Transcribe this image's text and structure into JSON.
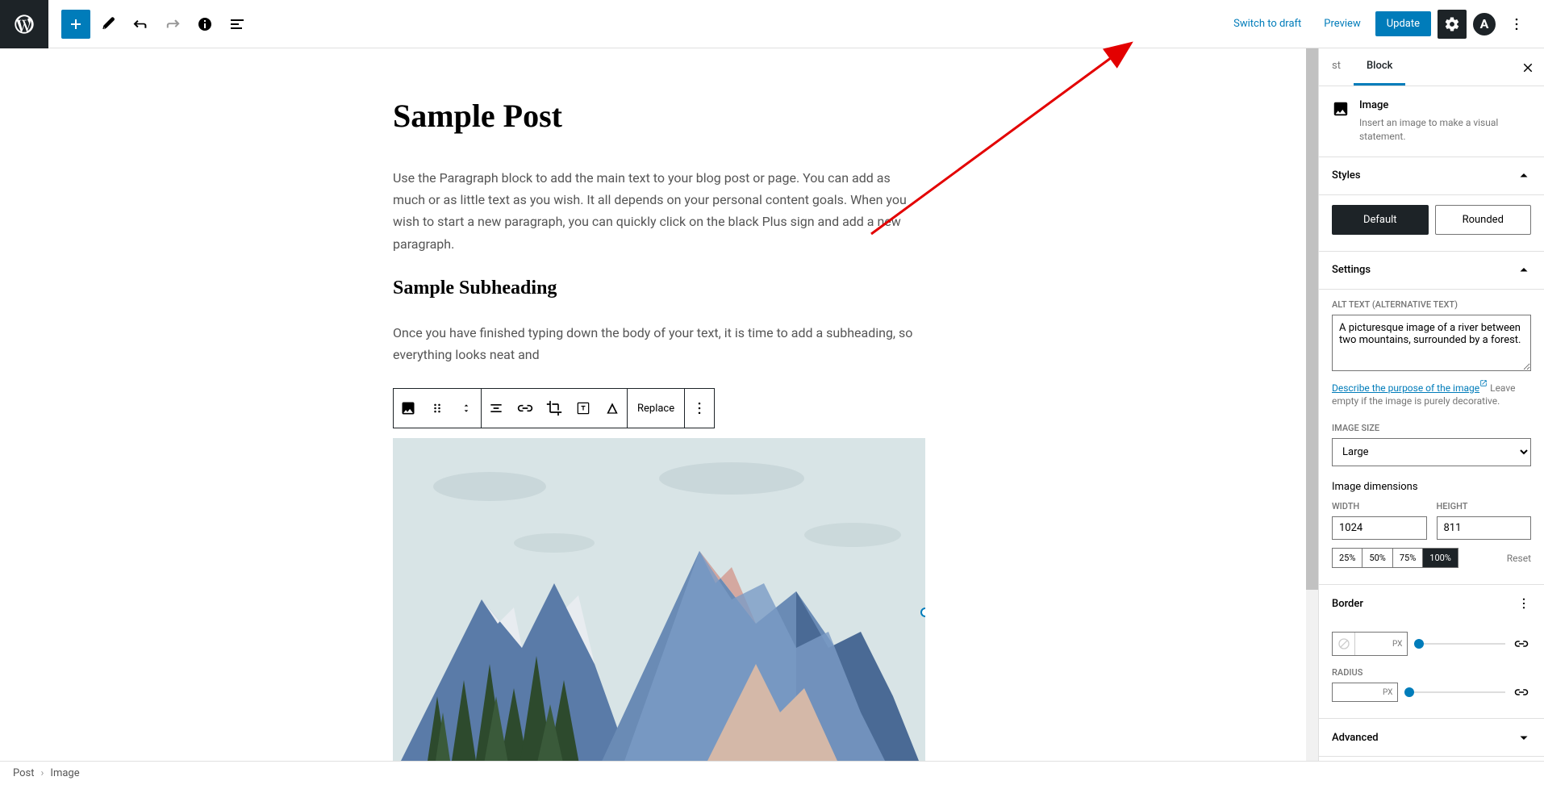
{
  "toolbar": {
    "switch_draft": "Switch to draft",
    "preview": "Preview",
    "update": "Update"
  },
  "editor": {
    "title": "Sample Post",
    "paragraph1": "Use the Paragraph block to add the main text to your blog post or page. You can add as much or as little text as you wish. It all depends on your personal content goals. When you wish to start a new paragraph, you can quickly click on the black Plus sign and add a new paragraph.",
    "subheading": "Sample Subheading",
    "paragraph2": "Once you have finished typing down the body of your text, it is time to add a subheading, so everything looks neat and",
    "replace_btn": "Replace"
  },
  "sidebar": {
    "tab_post": "st",
    "tab_block": "Block",
    "block_name": "Image",
    "block_desc": "Insert an image to make a visual statement.",
    "styles_header": "Styles",
    "style_default": "Default",
    "style_rounded": "Rounded",
    "settings_header": "Settings",
    "alt_label": "ALT TEXT (ALTERNATIVE TEXT)",
    "alt_value": "A picturesque image of a river between two mountains, surrounded by a forest.",
    "alt_help_link": "Describe the purpose of the image",
    "alt_help_text": "Leave empty if the image is purely decorative.",
    "size_label": "IMAGE SIZE",
    "size_value": "Large",
    "dim_label": "Image dimensions",
    "width_label": "WIDTH",
    "width_value": "1024",
    "height_label": "HEIGHT",
    "height_value": "811",
    "p25": "25%",
    "p50": "50%",
    "p75": "75%",
    "p100": "100%",
    "reset": "Reset",
    "border_label": "Border",
    "px": "PX",
    "radius_label": "RADIUS",
    "advanced_header": "Advanced"
  },
  "footer": {
    "crumb1": "Post",
    "crumb2": "Image"
  }
}
